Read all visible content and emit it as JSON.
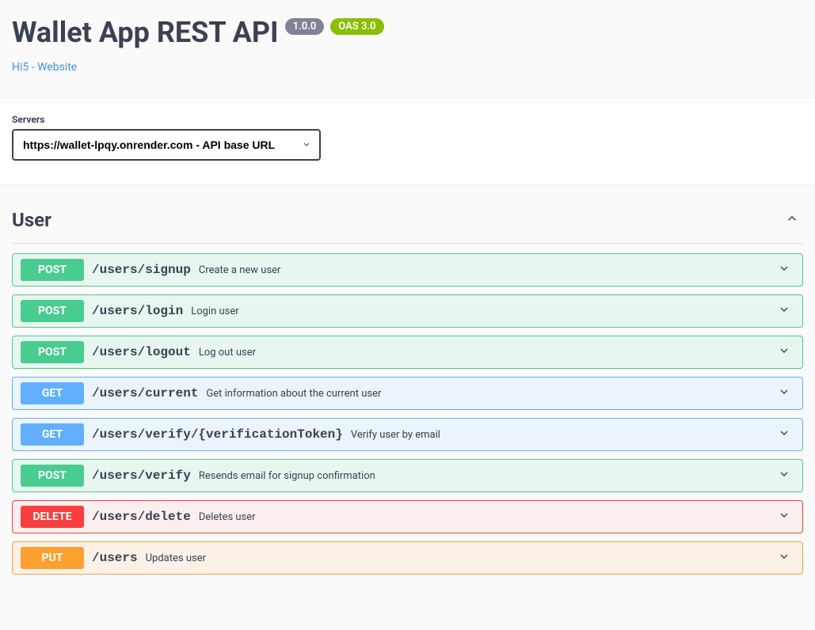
{
  "header": {
    "title": "Wallet App REST API",
    "version_badge": "1.0.0",
    "oas_badge": "OAS 3.0",
    "link_text": "Hi5 - Website"
  },
  "servers": {
    "label": "Servers",
    "selected": "https://wallet-lpqy.onrender.com - API base URL"
  },
  "tag": {
    "name": "User"
  },
  "ops": [
    {
      "method": "POST",
      "method_class": "post",
      "path": "/users/signup",
      "summary": "Create a new user"
    },
    {
      "method": "POST",
      "method_class": "post",
      "path": "/users/login",
      "summary": "Login user"
    },
    {
      "method": "POST",
      "method_class": "post",
      "path": "/users/logout",
      "summary": "Log out user"
    },
    {
      "method": "GET",
      "method_class": "get",
      "path": "/users/current",
      "summary": "Get information about the current user"
    },
    {
      "method": "GET",
      "method_class": "get",
      "path": "/users/verify/{verificationToken}",
      "summary": "Verify user by email"
    },
    {
      "method": "POST",
      "method_class": "post",
      "path": "/users/verify",
      "summary": "Resends email for signup confirmation"
    },
    {
      "method": "DELETE",
      "method_class": "delete",
      "path": "/users/delete",
      "summary": "Deletes user"
    },
    {
      "method": "PUT",
      "method_class": "put",
      "path": "/users",
      "summary": "Updates user"
    }
  ]
}
